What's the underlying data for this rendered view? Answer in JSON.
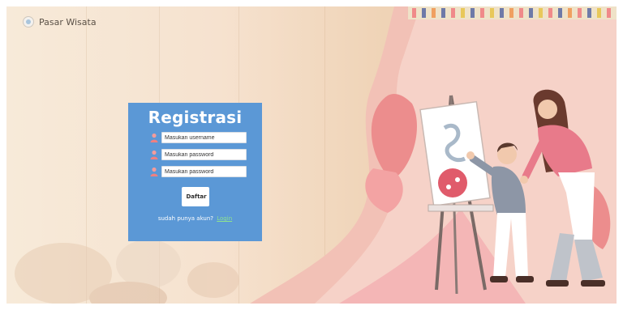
{
  "brand": {
    "name": "Pasar Wisata"
  },
  "form": {
    "title": "Registrasi",
    "username_placeholder": "Masukan username",
    "password_placeholder": "Masukan password",
    "confirm_placeholder": "Masukan password",
    "submit_label": "Daftar",
    "footer_prompt": "sudah punya akun?",
    "footer_link": "Login"
  },
  "colors": {
    "card": "#5b98d6",
    "link": "#8fe38f"
  },
  "icons": {
    "field_icon": "user-icon",
    "brand_icon": "logo-icon"
  }
}
